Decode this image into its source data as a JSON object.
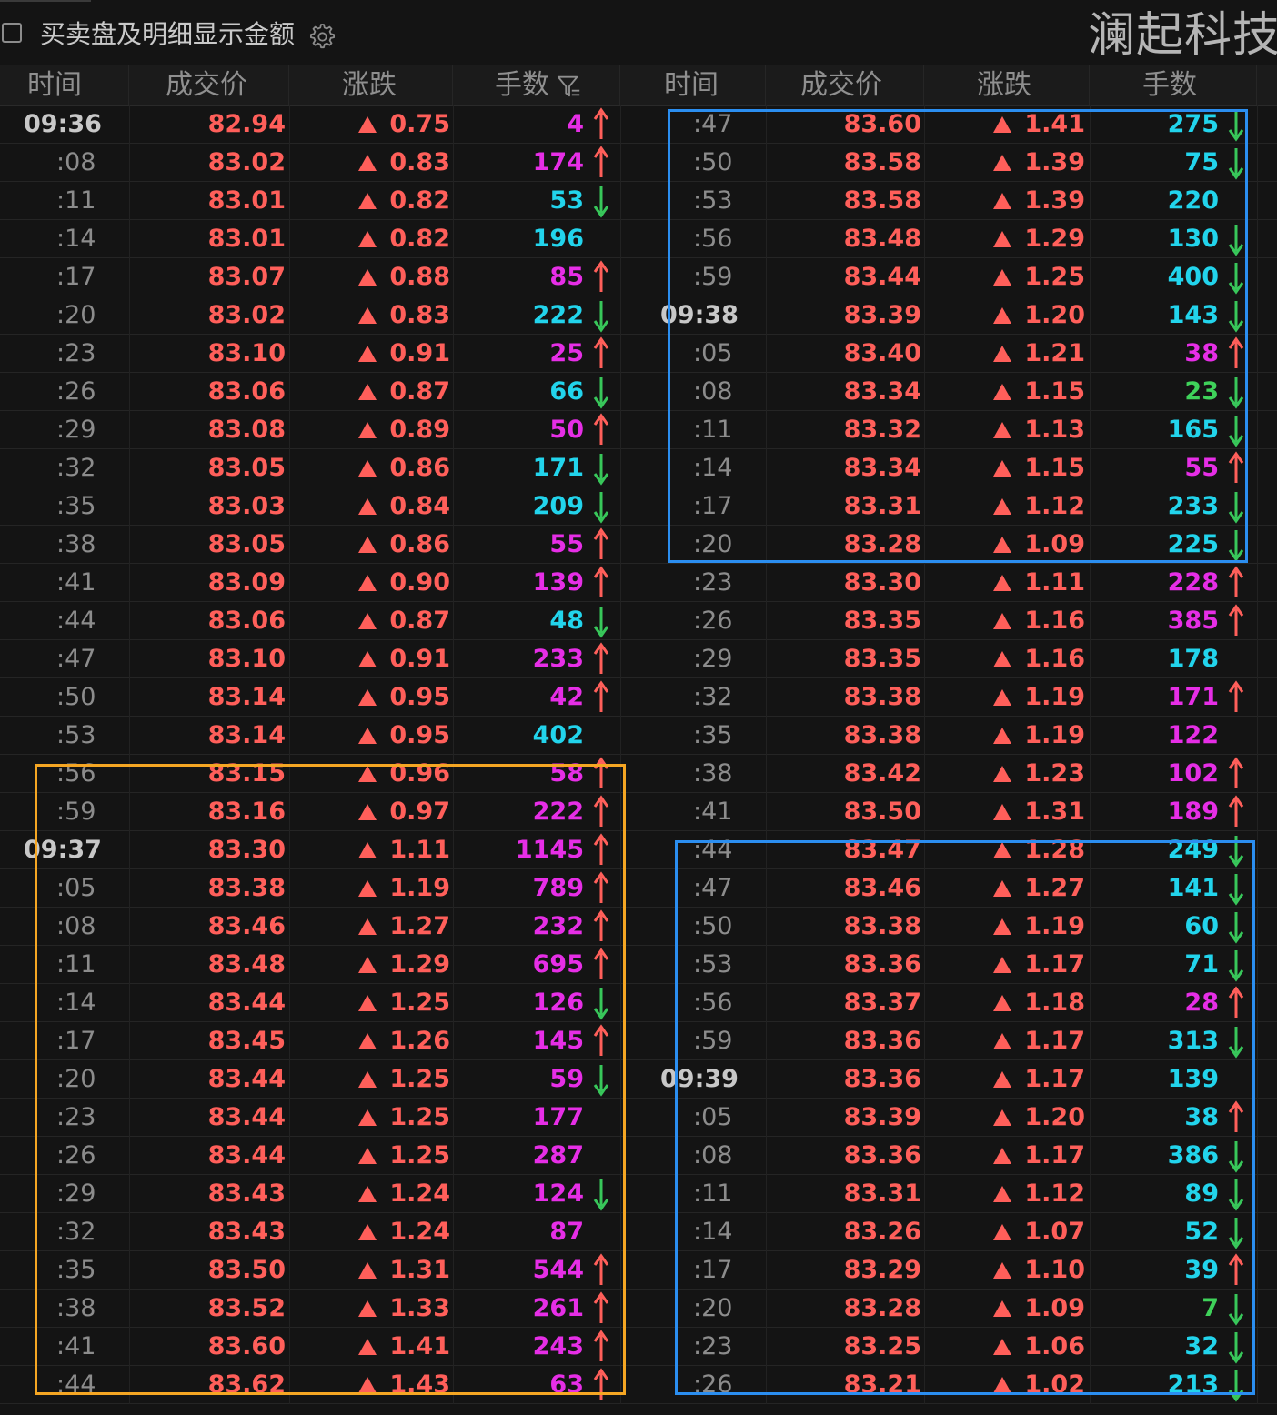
{
  "header": {
    "checkbox_label": "买卖盘及明细显示金额",
    "stock_name": "澜起科技分"
  },
  "columns": [
    "时间",
    "成交价",
    "涨跌",
    "手数"
  ],
  "colors": {
    "background": "#141414",
    "up_red": "#ff5f5a",
    "buy_magenta": "#e62ee6",
    "sell_cyan": "#22d4ec",
    "neutral_green": "#3fd25a",
    "arrow_green": "#38c75a",
    "highlight_orange": "#f5a623",
    "highlight_blue": "#2b8ef0"
  },
  "left_rows": [
    {
      "time": "09:36",
      "price": "82.94",
      "change": "0.75",
      "volume": "4",
      "vcolor": "magenta",
      "arrow": "up"
    },
    {
      "time": ":08",
      "price": "83.02",
      "change": "0.83",
      "volume": "174",
      "vcolor": "magenta",
      "arrow": "up"
    },
    {
      "time": ":11",
      "price": "83.01",
      "change": "0.82",
      "volume": "53",
      "vcolor": "cyan",
      "arrow": "down"
    },
    {
      "time": ":14",
      "price": "83.01",
      "change": "0.82",
      "volume": "196",
      "vcolor": "cyan",
      "arrow": ""
    },
    {
      "time": ":17",
      "price": "83.07",
      "change": "0.88",
      "volume": "85",
      "vcolor": "magenta",
      "arrow": "up"
    },
    {
      "time": ":20",
      "price": "83.02",
      "change": "0.83",
      "volume": "222",
      "vcolor": "cyan",
      "arrow": "down"
    },
    {
      "time": ":23",
      "price": "83.10",
      "change": "0.91",
      "volume": "25",
      "vcolor": "magenta",
      "arrow": "up"
    },
    {
      "time": ":26",
      "price": "83.06",
      "change": "0.87",
      "volume": "66",
      "vcolor": "cyan",
      "arrow": "down"
    },
    {
      "time": ":29",
      "price": "83.08",
      "change": "0.89",
      "volume": "50",
      "vcolor": "magenta",
      "arrow": "up"
    },
    {
      "time": ":32",
      "price": "83.05",
      "change": "0.86",
      "volume": "171",
      "vcolor": "cyan",
      "arrow": "down"
    },
    {
      "time": ":35",
      "price": "83.03",
      "change": "0.84",
      "volume": "209",
      "vcolor": "cyan",
      "arrow": "down"
    },
    {
      "time": ":38",
      "price": "83.05",
      "change": "0.86",
      "volume": "55",
      "vcolor": "magenta",
      "arrow": "up"
    },
    {
      "time": ":41",
      "price": "83.09",
      "change": "0.90",
      "volume": "139",
      "vcolor": "magenta",
      "arrow": "up"
    },
    {
      "time": ":44",
      "price": "83.06",
      "change": "0.87",
      "volume": "48",
      "vcolor": "cyan",
      "arrow": "down"
    },
    {
      "time": ":47",
      "price": "83.10",
      "change": "0.91",
      "volume": "233",
      "vcolor": "magenta",
      "arrow": "up"
    },
    {
      "time": ":50",
      "price": "83.14",
      "change": "0.95",
      "volume": "42",
      "vcolor": "magenta",
      "arrow": "up"
    },
    {
      "time": ":53",
      "price": "83.14",
      "change": "0.95",
      "volume": "402",
      "vcolor": "cyan",
      "arrow": ""
    },
    {
      "time": ":56",
      "price": "83.15",
      "change": "0.96",
      "volume": "58",
      "vcolor": "magenta",
      "arrow": "up"
    },
    {
      "time": ":59",
      "price": "83.16",
      "change": "0.97",
      "volume": "222",
      "vcolor": "magenta",
      "arrow": "up"
    },
    {
      "time": "09:37",
      "price": "83.30",
      "change": "1.11",
      "volume": "1145",
      "vcolor": "magenta",
      "arrow": "up"
    },
    {
      "time": ":05",
      "price": "83.38",
      "change": "1.19",
      "volume": "789",
      "vcolor": "magenta",
      "arrow": "up"
    },
    {
      "time": ":08",
      "price": "83.46",
      "change": "1.27",
      "volume": "232",
      "vcolor": "magenta",
      "arrow": "up"
    },
    {
      "time": ":11",
      "price": "83.48",
      "change": "1.29",
      "volume": "695",
      "vcolor": "magenta",
      "arrow": "up"
    },
    {
      "time": ":14",
      "price": "83.44",
      "change": "1.25",
      "volume": "126",
      "vcolor": "magenta",
      "arrow": "down"
    },
    {
      "time": ":17",
      "price": "83.45",
      "change": "1.26",
      "volume": "145",
      "vcolor": "magenta",
      "arrow": "up"
    },
    {
      "time": ":20",
      "price": "83.44",
      "change": "1.25",
      "volume": "59",
      "vcolor": "magenta",
      "arrow": "down"
    },
    {
      "time": ":23",
      "price": "83.44",
      "change": "1.25",
      "volume": "177",
      "vcolor": "magenta",
      "arrow": ""
    },
    {
      "time": ":26",
      "price": "83.44",
      "change": "1.25",
      "volume": "287",
      "vcolor": "magenta",
      "arrow": ""
    },
    {
      "time": ":29",
      "price": "83.43",
      "change": "1.24",
      "volume": "124",
      "vcolor": "magenta",
      "arrow": "down"
    },
    {
      "time": ":32",
      "price": "83.43",
      "change": "1.24",
      "volume": "87",
      "vcolor": "magenta",
      "arrow": ""
    },
    {
      "time": ":35",
      "price": "83.50",
      "change": "1.31",
      "volume": "544",
      "vcolor": "magenta",
      "arrow": "up"
    },
    {
      "time": ":38",
      "price": "83.52",
      "change": "1.33",
      "volume": "261",
      "vcolor": "magenta",
      "arrow": "up"
    },
    {
      "time": ":41",
      "price": "83.60",
      "change": "1.41",
      "volume": "243",
      "vcolor": "magenta",
      "arrow": "up"
    },
    {
      "time": ":44",
      "price": "83.62",
      "change": "1.43",
      "volume": "63",
      "vcolor": "magenta",
      "arrow": "up"
    }
  ],
  "right_rows": [
    {
      "time": ":47",
      "price": "83.60",
      "change": "1.41",
      "volume": "275",
      "vcolor": "cyan",
      "arrow": "down"
    },
    {
      "time": ":50",
      "price": "83.58",
      "change": "1.39",
      "volume": "75",
      "vcolor": "cyan",
      "arrow": "down"
    },
    {
      "time": ":53",
      "price": "83.58",
      "change": "1.39",
      "volume": "220",
      "vcolor": "cyan",
      "arrow": ""
    },
    {
      "time": ":56",
      "price": "83.48",
      "change": "1.29",
      "volume": "130",
      "vcolor": "cyan",
      "arrow": "down"
    },
    {
      "time": ":59",
      "price": "83.44",
      "change": "1.25",
      "volume": "400",
      "vcolor": "cyan",
      "arrow": "down"
    },
    {
      "time": "09:38",
      "price": "83.39",
      "change": "1.20",
      "volume": "143",
      "vcolor": "cyan",
      "arrow": "down"
    },
    {
      "time": ":05",
      "price": "83.40",
      "change": "1.21",
      "volume": "38",
      "vcolor": "magenta",
      "arrow": "up"
    },
    {
      "time": ":08",
      "price": "83.34",
      "change": "1.15",
      "volume": "23",
      "vcolor": "green",
      "arrow": "down"
    },
    {
      "time": ":11",
      "price": "83.32",
      "change": "1.13",
      "volume": "165",
      "vcolor": "cyan",
      "arrow": "down"
    },
    {
      "time": ":14",
      "price": "83.34",
      "change": "1.15",
      "volume": "55",
      "vcolor": "magenta",
      "arrow": "up"
    },
    {
      "time": ":17",
      "price": "83.31",
      "change": "1.12",
      "volume": "233",
      "vcolor": "cyan",
      "arrow": "down"
    },
    {
      "time": ":20",
      "price": "83.28",
      "change": "1.09",
      "volume": "225",
      "vcolor": "cyan",
      "arrow": "down"
    },
    {
      "time": ":23",
      "price": "83.30",
      "change": "1.11",
      "volume": "228",
      "vcolor": "magenta",
      "arrow": "up"
    },
    {
      "time": ":26",
      "price": "83.35",
      "change": "1.16",
      "volume": "385",
      "vcolor": "magenta",
      "arrow": "up"
    },
    {
      "time": ":29",
      "price": "83.35",
      "change": "1.16",
      "volume": "178",
      "vcolor": "cyan",
      "arrow": ""
    },
    {
      "time": ":32",
      "price": "83.38",
      "change": "1.19",
      "volume": "171",
      "vcolor": "magenta",
      "arrow": "up"
    },
    {
      "time": ":35",
      "price": "83.38",
      "change": "1.19",
      "volume": "122",
      "vcolor": "magenta",
      "arrow": ""
    },
    {
      "time": ":38",
      "price": "83.42",
      "change": "1.23",
      "volume": "102",
      "vcolor": "magenta",
      "arrow": "up"
    },
    {
      "time": ":41",
      "price": "83.50",
      "change": "1.31",
      "volume": "189",
      "vcolor": "magenta",
      "arrow": "up"
    },
    {
      "time": ":44",
      "price": "83.47",
      "change": "1.28",
      "volume": "249",
      "vcolor": "cyan",
      "arrow": "down"
    },
    {
      "time": ":47",
      "price": "83.46",
      "change": "1.27",
      "volume": "141",
      "vcolor": "cyan",
      "arrow": "down"
    },
    {
      "time": ":50",
      "price": "83.38",
      "change": "1.19",
      "volume": "60",
      "vcolor": "cyan",
      "arrow": "down"
    },
    {
      "time": ":53",
      "price": "83.36",
      "change": "1.17",
      "volume": "71",
      "vcolor": "cyan",
      "arrow": "down"
    },
    {
      "time": ":56",
      "price": "83.37",
      "change": "1.18",
      "volume": "28",
      "vcolor": "magenta",
      "arrow": "up"
    },
    {
      "time": ":59",
      "price": "83.36",
      "change": "1.17",
      "volume": "313",
      "vcolor": "cyan",
      "arrow": "down"
    },
    {
      "time": "09:39",
      "price": "83.36",
      "change": "1.17",
      "volume": "139",
      "vcolor": "cyan",
      "arrow": ""
    },
    {
      "time": ":05",
      "price": "83.39",
      "change": "1.20",
      "volume": "38",
      "vcolor": "cyan",
      "arrow": "up"
    },
    {
      "time": ":08",
      "price": "83.36",
      "change": "1.17",
      "volume": "386",
      "vcolor": "cyan",
      "arrow": "down"
    },
    {
      "time": ":11",
      "price": "83.31",
      "change": "1.12",
      "volume": "89",
      "vcolor": "cyan",
      "arrow": "down"
    },
    {
      "time": ":14",
      "price": "83.26",
      "change": "1.07",
      "volume": "52",
      "vcolor": "cyan",
      "arrow": "down"
    },
    {
      "time": ":17",
      "price": "83.29",
      "change": "1.10",
      "volume": "39",
      "vcolor": "cyan",
      "arrow": "up"
    },
    {
      "time": ":20",
      "price": "83.28",
      "change": "1.09",
      "volume": "7",
      "vcolor": "green",
      "arrow": "down"
    },
    {
      "time": ":23",
      "price": "83.25",
      "change": "1.06",
      "volume": "32",
      "vcolor": "cyan",
      "arrow": "down"
    },
    {
      "time": ":26",
      "price": "83.21",
      "change": "1.02",
      "volume": "213",
      "vcolor": "cyan",
      "arrow": "down"
    }
  ],
  "highlights": [
    {
      "panel": "left",
      "from_row": 17,
      "to_row": 33,
      "color": "orange"
    },
    {
      "panel": "right",
      "from_row": 0,
      "to_row": 11,
      "color": "blue"
    },
    {
      "panel": "right",
      "from_row": 19,
      "to_row": 33,
      "color": "blue"
    }
  ]
}
